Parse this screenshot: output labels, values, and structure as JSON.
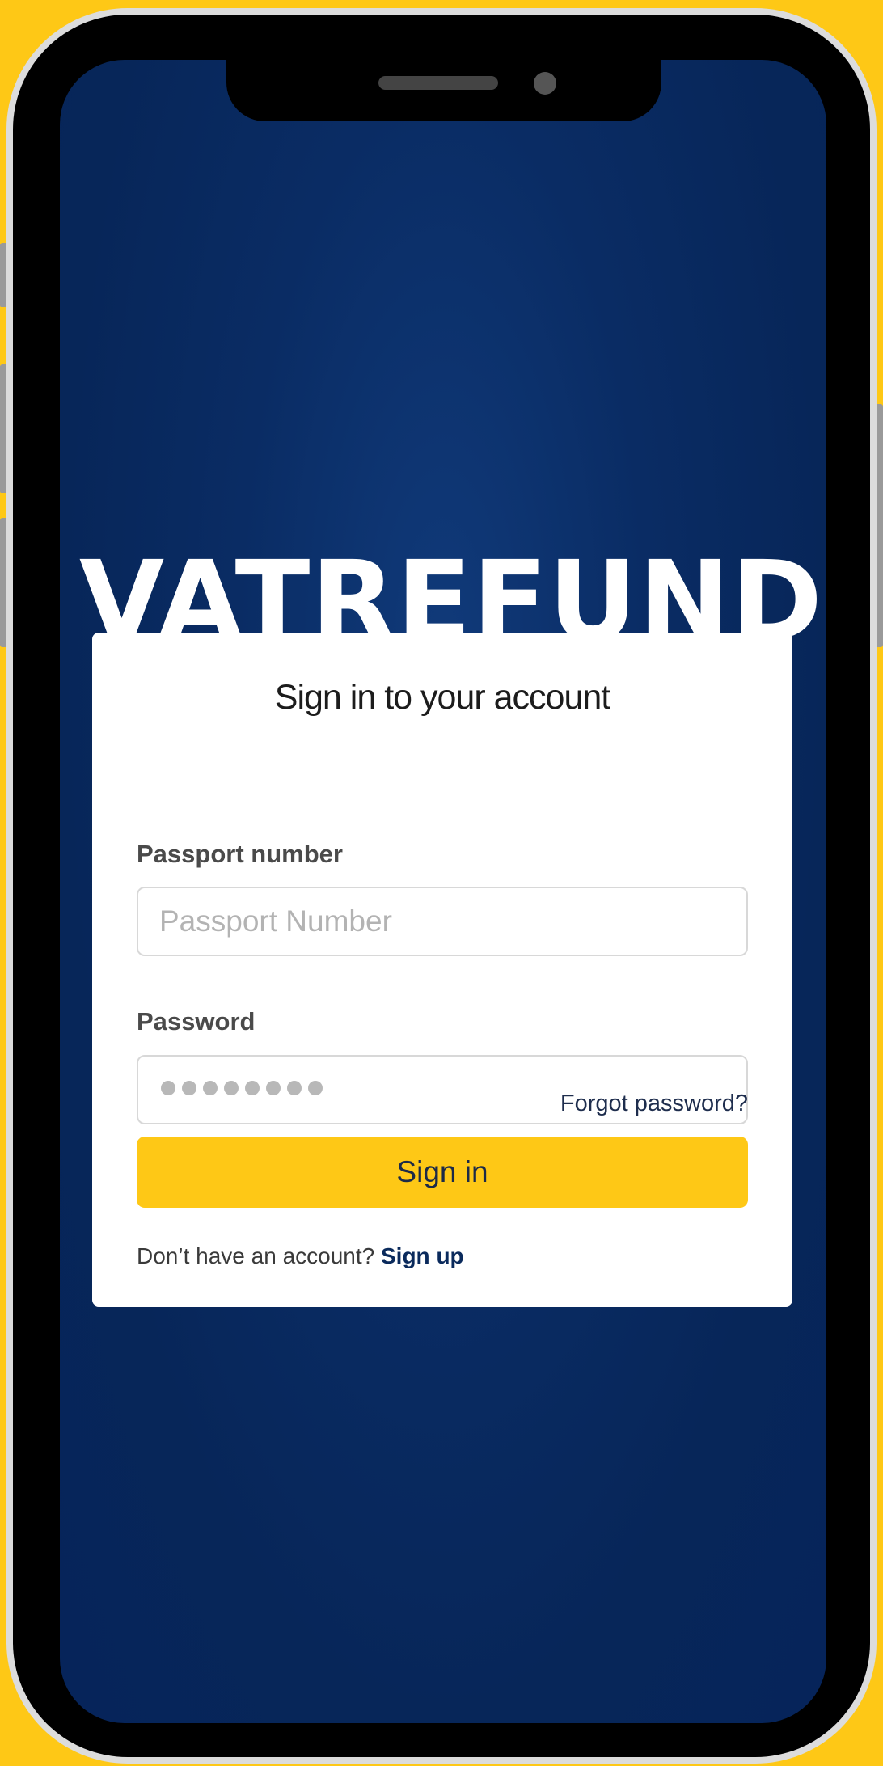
{
  "app": {
    "brand": "VATREFUND"
  },
  "login": {
    "title": "Sign in to your account",
    "passport_label": "Passport number",
    "passport_placeholder": "Passport Number",
    "password_label": "Password",
    "password_mask_count": 8,
    "forgot_link": "Forgot password?",
    "signin_button": "Sign in",
    "signup_prompt": "Don’t have an account?",
    "signup_link": "Sign up"
  },
  "colors": {
    "background": "#FEC816",
    "screen": "#072659",
    "accent": "#FEC816",
    "card": "#FFFFFF"
  }
}
